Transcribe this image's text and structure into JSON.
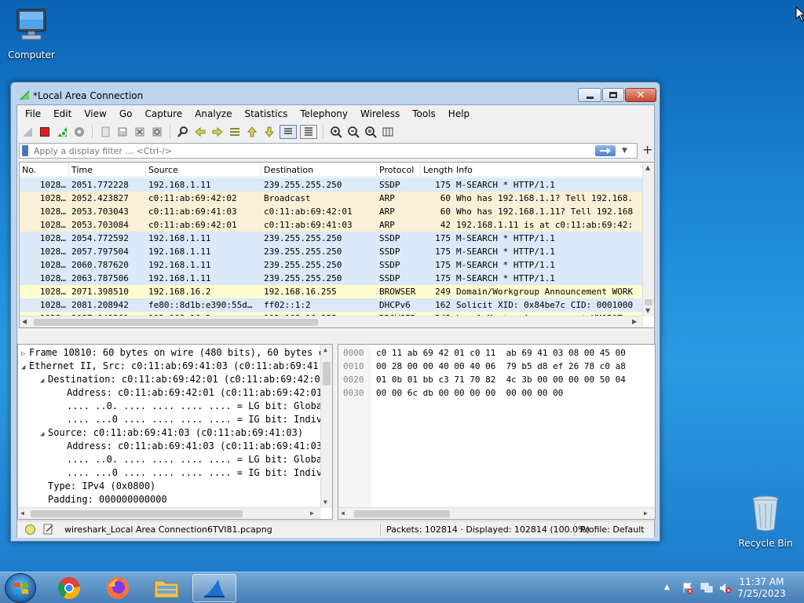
{
  "desktop": {
    "icons": [
      {
        "label": "Computer"
      },
      {
        "label": "Recycle Bin"
      }
    ]
  },
  "window": {
    "title": "*Local Area Connection",
    "close_glyph": "✕"
  },
  "menu": [
    "File",
    "Edit",
    "View",
    "Go",
    "Capture",
    "Analyze",
    "Statistics",
    "Telephony",
    "Wireless",
    "Tools",
    "Help"
  ],
  "filter": {
    "placeholder": "Apply a display filter ... <Ctrl-/>",
    "add_label": "+"
  },
  "packet_list": {
    "columns": [
      "No.",
      "Time",
      "Source",
      "Destination",
      "Protocol",
      "Length",
      "Info"
    ],
    "rows": [
      {
        "no": "1028…",
        "time": "2051.772228",
        "src": "192.168.1.11",
        "dst": "239.255.255.250",
        "proto": "SSDP",
        "len": "175",
        "info": "M-SEARCH * HTTP/1.1",
        "bg": "#dbe9f9"
      },
      {
        "no": "1028…",
        "time": "2052.423827",
        "src": "c0:11:ab:69:42:02",
        "dst": "Broadcast",
        "proto": "ARP",
        "len": "60",
        "info": "Who has 192.168.1.1? Tell 192.168.",
        "bg": "#faf0d7"
      },
      {
        "no": "1028…",
        "time": "2053.703043",
        "src": "c0:11:ab:69:41:03",
        "dst": "c0:11:ab:69:42:01",
        "proto": "ARP",
        "len": "60",
        "info": "Who has 192.168.1.11? Tell 192.168",
        "bg": "#faf0d7"
      },
      {
        "no": "1028…",
        "time": "2053.703084",
        "src": "c0:11:ab:69:42:01",
        "dst": "c0:11:ab:69:41:03",
        "proto": "ARP",
        "len": "42",
        "info": "192.168.1.11 is at c0:11:ab:69:42:",
        "bg": "#faf0d7"
      },
      {
        "no": "1028…",
        "time": "2054.772592",
        "src": "192.168.1.11",
        "dst": "239.255.255.250",
        "proto": "SSDP",
        "len": "175",
        "info": "M-SEARCH * HTTP/1.1",
        "bg": "#dbe9f9"
      },
      {
        "no": "1028…",
        "time": "2057.797504",
        "src": "192.168.1.11",
        "dst": "239.255.255.250",
        "proto": "SSDP",
        "len": "175",
        "info": "M-SEARCH * HTTP/1.1",
        "bg": "#dbe9f9"
      },
      {
        "no": "1028…",
        "time": "2060.787620",
        "src": "192.168.1.11",
        "dst": "239.255.255.250",
        "proto": "SSDP",
        "len": "175",
        "info": "M-SEARCH * HTTP/1.1",
        "bg": "#dbe9f9"
      },
      {
        "no": "1028…",
        "time": "2063.787506",
        "src": "192.168.1.11",
        "dst": "239.255.255.250",
        "proto": "SSDP",
        "len": "175",
        "info": "M-SEARCH * HTTP/1.1",
        "bg": "#dbe9f9"
      },
      {
        "no": "1028…",
        "time": "2071.398510",
        "src": "192.168.16.2",
        "dst": "192.168.16.255",
        "proto": "BROWSER",
        "len": "249",
        "info": "Domain/Workgroup Announcement WORK",
        "bg": "#fefcd0"
      },
      {
        "no": "1028…",
        "time": "2081.208942",
        "src": "fe80::8d1b:e390:55d…",
        "dst": "ff02::1:2",
        "proto": "DHCPv6",
        "len": "162",
        "info": "Solicit XID: 0x84be7c CID: 0001000",
        "bg": "#dbe9f9"
      },
      {
        "no": "1028…",
        "time": "2087.949561",
        "src": "192.168.16.2",
        "dst": "192.168.16.255",
        "proto": "BROWSER",
        "len": "243",
        "info": "Local Master Announcement VM0B0T,",
        "bg": "#fefcd0"
      }
    ]
  },
  "details": {
    "lines": [
      {
        "text": "Frame 10810: 60 bytes on wire (480 bits), 60 bytes c",
        "toggle": "▷"
      },
      {
        "text": "Ethernet II, Src: c0:11:ab:69:41:03 (c0:11:ab:69:41:",
        "toggle": "◢"
      },
      {
        "text": "Destination: c0:11:ab:69:42:01 (c0:11:ab:69:42:01",
        "toggle": "◢"
      },
      {
        "text": "Address: c0:11:ab:69:42:01 (c0:11:ab:69:42:01)",
        "toggle": ""
      },
      {
        "text": ".... ..0. .... .... .... .... = LG bit: Global",
        "toggle": ""
      },
      {
        "text": ".... ...0 .... .... .... .... = IG bit: Indivi",
        "toggle": ""
      },
      {
        "text": "Source: c0:11:ab:69:41:03 (c0:11:ab:69:41:03)",
        "toggle": "◢"
      },
      {
        "text": "Address: c0:11:ab:69:41:03 (c0:11:ab:69:41:03)",
        "toggle": ""
      },
      {
        "text": ".... ..0. .... .... .... .... = LG bit: Global",
        "toggle": ""
      },
      {
        "text": ".... ...0 .... .... .... .... = IG bit: Indivi",
        "toggle": ""
      },
      {
        "text": "Type: IPv4 (0x0800)",
        "toggle": ""
      },
      {
        "text": "Padding: 000000000000",
        "toggle": ""
      }
    ]
  },
  "bytes": {
    "offsets": [
      "0000",
      "0010",
      "0020",
      "0030"
    ],
    "hex": [
      "c0 11 ab 69 42 01 c0 11  ab 69 41 03 08 00 45 00",
      "00 28 00 00 40 00 40 06  79 b5 d8 ef 26 78 c0 a8",
      "01 0b 01 bb c3 71 70 82  4c 3b 00 00 00 00 50 04",
      "00 00 6c db 00 00 00 00  00 00 00 00"
    ]
  },
  "status": {
    "file": "wireshark_Local Area Connection6TVI81.pcapng",
    "packets": "Packets: 102814 · Displayed: 102814 (100.0%)",
    "profile": "Profile: Default"
  },
  "taskbar": {
    "time": "11:37 AM",
    "date": "7/25/2023",
    "tray_up": "▲"
  },
  "colors": {
    "ssdp_row": "#dbe9f9",
    "arp_row": "#faf0d7",
    "browser_row": "#fefcd0"
  }
}
